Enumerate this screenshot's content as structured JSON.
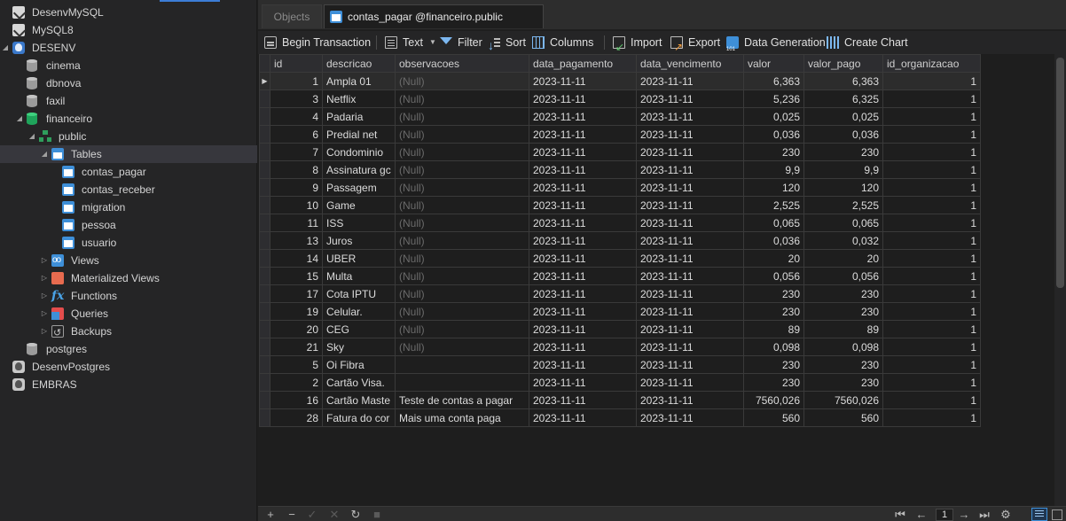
{
  "sidebar": {
    "items": [
      {
        "label": "DesenvMySQL",
        "icon": "mysql-connection-icon"
      },
      {
        "label": "MySQL8",
        "icon": "mysql-connection-icon"
      },
      {
        "label": "DESENV",
        "icon": "postgres-connection-icon"
      },
      {
        "label": "cinema",
        "icon": "database-icon"
      },
      {
        "label": "dbnova",
        "icon": "database-icon"
      },
      {
        "label": "faxil",
        "icon": "database-icon"
      },
      {
        "label": "financeiro",
        "icon": "database-icon"
      },
      {
        "label": "public",
        "icon": "schema-icon"
      },
      {
        "label": "Tables",
        "icon": "tables-icon"
      },
      {
        "label": "contas_pagar",
        "icon": "table-icon"
      },
      {
        "label": "contas_receber",
        "icon": "table-icon"
      },
      {
        "label": "migration",
        "icon": "table-icon"
      },
      {
        "label": "pessoa",
        "icon": "table-icon"
      },
      {
        "label": "usuario",
        "icon": "table-icon"
      },
      {
        "label": "Views",
        "icon": "views-icon"
      },
      {
        "label": "Materialized Views",
        "icon": "materialized-views-icon"
      },
      {
        "label": "Functions",
        "icon": "functions-icon"
      },
      {
        "label": "Queries",
        "icon": "queries-icon"
      },
      {
        "label": "Backups",
        "icon": "backups-icon"
      },
      {
        "label": "postgres",
        "icon": "database-icon"
      },
      {
        "label": "DesenvPostgres",
        "icon": "postgres-connection-icon"
      },
      {
        "label": "EMBRAS",
        "icon": "postgres-connection-icon"
      }
    ]
  },
  "tabs": {
    "objects": "Objects",
    "active": "contas_pagar @financeiro.public (DESE..."
  },
  "toolbar": {
    "begin_transaction": "Begin Transaction",
    "text": "Text",
    "filter": "Filter",
    "sort": "Sort",
    "columns": "Columns",
    "import": "Import",
    "export": "Export",
    "data_generation": "Data Generation",
    "create_chart": "Create Chart"
  },
  "grid": {
    "columns": [
      "id",
      "descricao",
      "observacoes",
      "data_pagamento",
      "data_vencimento",
      "valor",
      "valor_pago",
      "id_organizacao"
    ],
    "rows": [
      [
        "1",
        "Ampla 01",
        "(Null)",
        "2023-11-11",
        "2023-11-11",
        "6,363",
        "6,363",
        "1"
      ],
      [
        "3",
        "Netflix",
        "(Null)",
        "2023-11-11",
        "2023-11-11",
        "5,236",
        "6,325",
        "1"
      ],
      [
        "4",
        "Padaria",
        "(Null)",
        "2023-11-11",
        "2023-11-11",
        "0,025",
        "0,025",
        "1"
      ],
      [
        "6",
        "Predial net",
        "(Null)",
        "2023-11-11",
        "2023-11-11",
        "0,036",
        "0,036",
        "1"
      ],
      [
        "7",
        "Condominio",
        "(Null)",
        "2023-11-11",
        "2023-11-11",
        "230",
        "230",
        "1"
      ],
      [
        "8",
        "Assinatura gc",
        "(Null)",
        "2023-11-11",
        "2023-11-11",
        "9,9",
        "9,9",
        "1"
      ],
      [
        "9",
        "Passagem",
        "(Null)",
        "2023-11-11",
        "2023-11-11",
        "120",
        "120",
        "1"
      ],
      [
        "10",
        "Game",
        "(Null)",
        "2023-11-11",
        "2023-11-11",
        "2,525",
        "2,525",
        "1"
      ],
      [
        "11",
        "ISS",
        "(Null)",
        "2023-11-11",
        "2023-11-11",
        "0,065",
        "0,065",
        "1"
      ],
      [
        "13",
        "Juros",
        "(Null)",
        "2023-11-11",
        "2023-11-11",
        "0,036",
        "0,032",
        "1"
      ],
      [
        "14",
        "UBER",
        "(Null)",
        "2023-11-11",
        "2023-11-11",
        "20",
        "20",
        "1"
      ],
      [
        "15",
        "Multa",
        "(Null)",
        "2023-11-11",
        "2023-11-11",
        "0,056",
        "0,056",
        "1"
      ],
      [
        "17",
        "Cota IPTU",
        "(Null)",
        "2023-11-11",
        "2023-11-11",
        "230",
        "230",
        "1"
      ],
      [
        "19",
        "Celular.",
        "(Null)",
        "2023-11-11",
        "2023-11-11",
        "230",
        "230",
        "1"
      ],
      [
        "20",
        "CEG",
        "(Null)",
        "2023-11-11",
        "2023-11-11",
        "89",
        "89",
        "1"
      ],
      [
        "21",
        "Sky",
        "(Null)",
        "2023-11-11",
        "2023-11-11",
        "0,098",
        "0,098",
        "1"
      ],
      [
        "5",
        "Oi Fibra",
        "",
        "2023-11-11",
        "2023-11-11",
        "230",
        "230",
        "1"
      ],
      [
        "2",
        "Cartão Visa.",
        "",
        "2023-11-11",
        "2023-11-11",
        "230",
        "230",
        "1"
      ],
      [
        "16",
        "Cartão Maste",
        "Teste de contas a pagar",
        "2023-11-11",
        "2023-11-11",
        "7560,026",
        "7560,026",
        "1"
      ],
      [
        "28",
        "Fatura do cor",
        "Mais uma conta paga",
        "2023-11-11",
        "2023-11-11",
        "560",
        "560",
        "1"
      ]
    ]
  },
  "bottombar": {
    "page": "1",
    "add": "+",
    "delete": "−",
    "apply": "✓",
    "discard": "✕",
    "refresh": "↻",
    "stop": "■",
    "first": "⏮",
    "prev": "←",
    "next": "→",
    "last": "⏭",
    "settings": "⚙"
  }
}
